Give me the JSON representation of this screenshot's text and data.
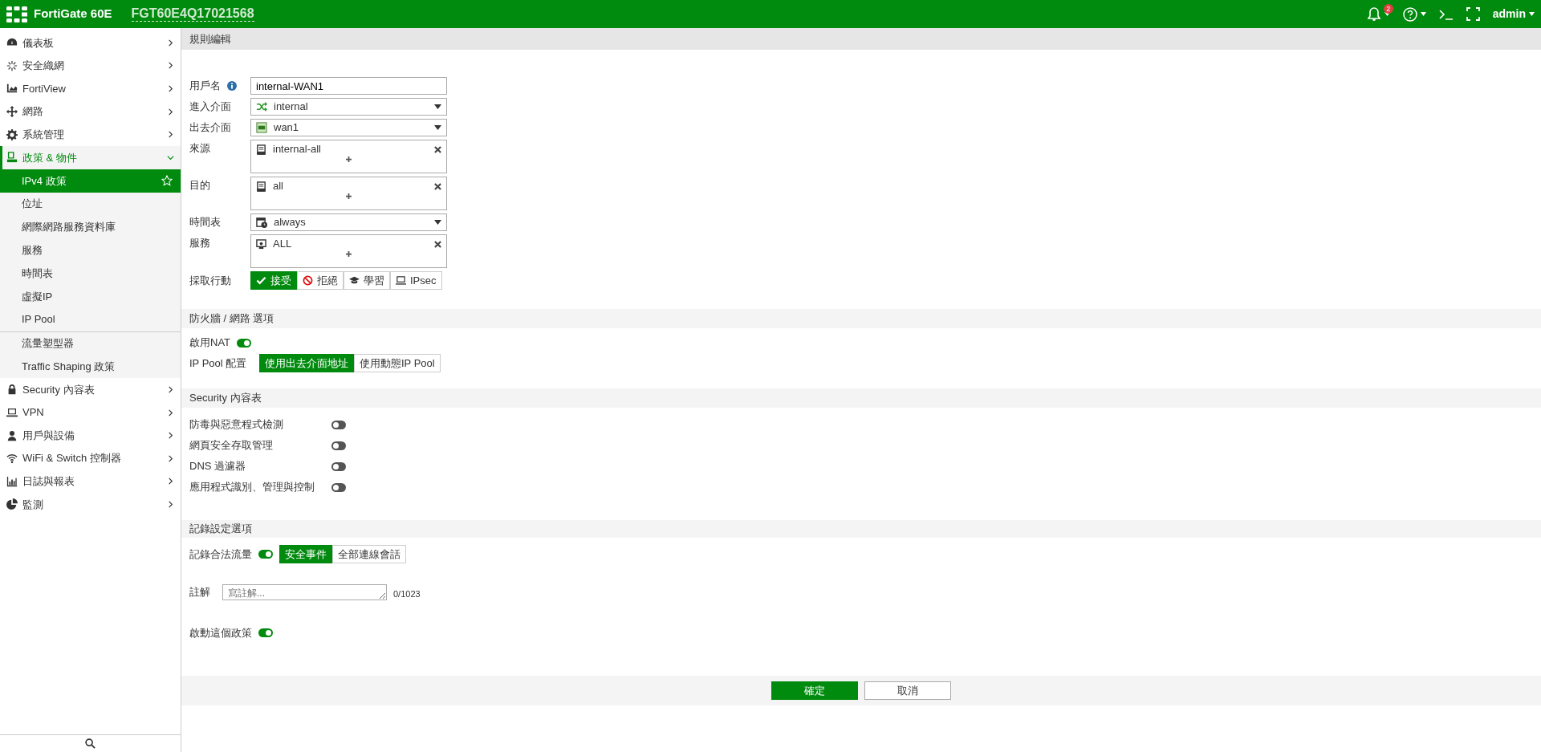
{
  "header": {
    "product": "FortiGate 60E",
    "serial": "FGT60E4Q17021568",
    "notification_count": "2",
    "user": "admin"
  },
  "sidebar": {
    "items": [
      {
        "label": "儀表板",
        "expanded": false
      },
      {
        "label": "安全織網",
        "expanded": false
      },
      {
        "label": "FortiView",
        "expanded": false
      },
      {
        "label": "網路",
        "expanded": false
      },
      {
        "label": "系統管理",
        "expanded": false
      },
      {
        "label": "政策 & 物件",
        "expanded": true,
        "groups": [
          [
            {
              "label": "IPv4 政策",
              "selected": true
            },
            {
              "label": "位址",
              "selected": false
            },
            {
              "label": "網際網路服務資料庫",
              "selected": false
            },
            {
              "label": "服務",
              "selected": false
            },
            {
              "label": "時間表",
              "selected": false
            },
            {
              "label": "虛擬IP",
              "selected": false
            },
            {
              "label": "IP Pool",
              "selected": false
            }
          ],
          [
            {
              "label": "流量塑型器",
              "selected": false
            },
            {
              "label": "Traffic Shaping 政策",
              "selected": false
            }
          ]
        ]
      },
      {
        "label": "Security 內容表",
        "expanded": false
      },
      {
        "label": "VPN",
        "expanded": false
      },
      {
        "label": "用戶與設備",
        "expanded": false
      },
      {
        "label": "WiFi & Switch 控制器",
        "expanded": false
      },
      {
        "label": "日誌與報表",
        "expanded": false
      },
      {
        "label": "監測",
        "expanded": false
      }
    ]
  },
  "form": {
    "title": "規則編輯",
    "fields": [
      {
        "kind": "text",
        "label": "用戶名",
        "info": true,
        "value": "internal-WAN1"
      },
      {
        "kind": "select",
        "label": "進入介面",
        "value": "internal"
      },
      {
        "kind": "select",
        "label": "出去介面",
        "value": "wan1"
      },
      {
        "kind": "multi",
        "label": "來源",
        "values": [
          "internal-all"
        ]
      },
      {
        "kind": "multi",
        "label": "目的",
        "values": [
          "all"
        ]
      },
      {
        "kind": "select",
        "label": "時間表",
        "value": "always"
      },
      {
        "kind": "multi",
        "label": "服務",
        "values": [
          "ALL"
        ]
      }
    ],
    "action": {
      "label": "採取行動",
      "options": [
        {
          "label": "接受",
          "selected": true
        },
        {
          "label": "拒絕",
          "selected": false
        },
        {
          "label": "學習",
          "selected": false
        },
        {
          "label": "IPsec",
          "selected": false
        }
      ]
    }
  },
  "firewall": {
    "title": "防火牆 / 網路 選項",
    "nat": {
      "label": "啟用NAT",
      "on": true
    },
    "ip_pool": {
      "label": "IP Pool 配置",
      "options": [
        {
          "label": "使用出去介面地址",
          "selected": true
        },
        {
          "label": "使用動態IP Pool",
          "selected": false
        }
      ]
    }
  },
  "security": {
    "title": "Security 內容表",
    "toggles": [
      {
        "label": "防毒與惡意程式檢測",
        "on": false
      },
      {
        "label": "網頁安全存取管理",
        "on": false
      },
      {
        "label": "DNS 過濾器",
        "on": false
      },
      {
        "label": "應用程式識別、管理與控制",
        "on": false
      }
    ]
  },
  "logging": {
    "title": "記錄設定選項",
    "log_traffic": {
      "label": "記錄合法流量",
      "on": true,
      "options": [
        {
          "label": "安全事件",
          "selected": true
        },
        {
          "label": "全部連線會話",
          "selected": false
        }
      ]
    },
    "comments": {
      "label": "註解",
      "placeholder": "寫註解...",
      "counter": "0/1023"
    },
    "enable": {
      "label": "啟動這個政策",
      "on": true
    }
  },
  "buttons": [
    {
      "label": "確定",
      "kind": "primary"
    },
    {
      "label": "取消",
      "kind": "secondary"
    }
  ]
}
